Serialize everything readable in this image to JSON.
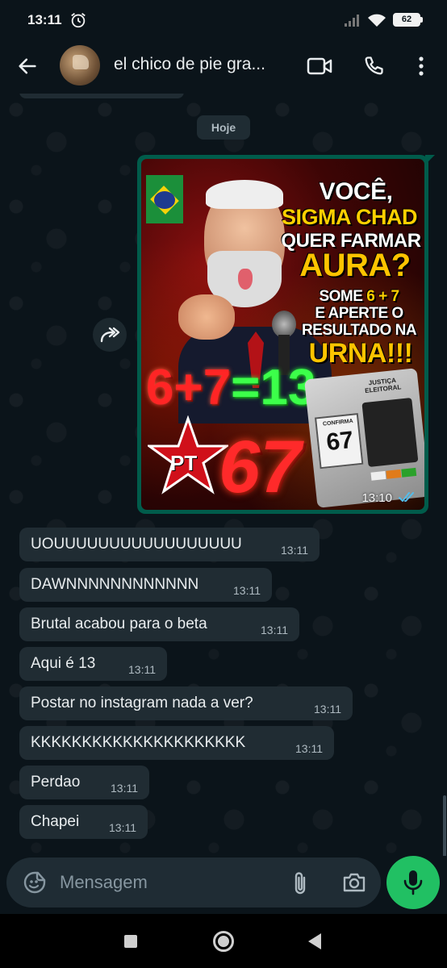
{
  "status_bar": {
    "time": "13:11",
    "battery": "62"
  },
  "header": {
    "contact_name": "el chico de pie gra...",
    "icons": [
      "back-arrow-icon",
      "video-call-icon",
      "phone-icon",
      "more-options-icon"
    ]
  },
  "chat": {
    "date_chip": "Hoje",
    "image_message": {
      "time": "13:10",
      "status": "read",
      "poster_text": {
        "line1": "VOCÊ,",
        "line2": "SIGMA CHAD",
        "line3": "QUER FARMAR",
        "line4": "AURA?",
        "line5_prefix": "SOME ",
        "line5_accent": "6 + 7",
        "line6": "E APERTE O",
        "line7": "RESULTADO NA",
        "line8": "URNA!!!",
        "equation_left": "6+7",
        "equation_eq": "=",
        "equation_right": "13",
        "party": "PT",
        "number": "67",
        "urna_label": "JUSTIÇA ELEITORAL",
        "urna_confirma": "CONFIRMA",
        "urna_number": "67"
      }
    },
    "messages": [
      {
        "text": "UOUUUUUUUUUUUUUUUUU",
        "time": "13:11"
      },
      {
        "text": "DAWNNNNNNNNNNNN",
        "time": "13:11"
      },
      {
        "text": "Brutal acabou para o beta",
        "time": "13:11"
      },
      {
        "text": "Aqui é 13",
        "time": "13:11"
      },
      {
        "text": "Postar no instagram nada a ver?",
        "time": "13:11"
      },
      {
        "text": "KKKKKKKKKKKKKKKKKKKKK",
        "time": "13:11"
      },
      {
        "text": "Perdao",
        "time": "13:11"
      },
      {
        "text": "Chapei",
        "time": "13:11"
      }
    ]
  },
  "input": {
    "placeholder": "Mensagem",
    "value": ""
  },
  "colors": {
    "background": "#0b141a",
    "incoming_bubble": "#202c33",
    "outgoing_bubble": "#005c4b",
    "accent_green": "#21c063",
    "read_ticks": "#53bdeb"
  }
}
